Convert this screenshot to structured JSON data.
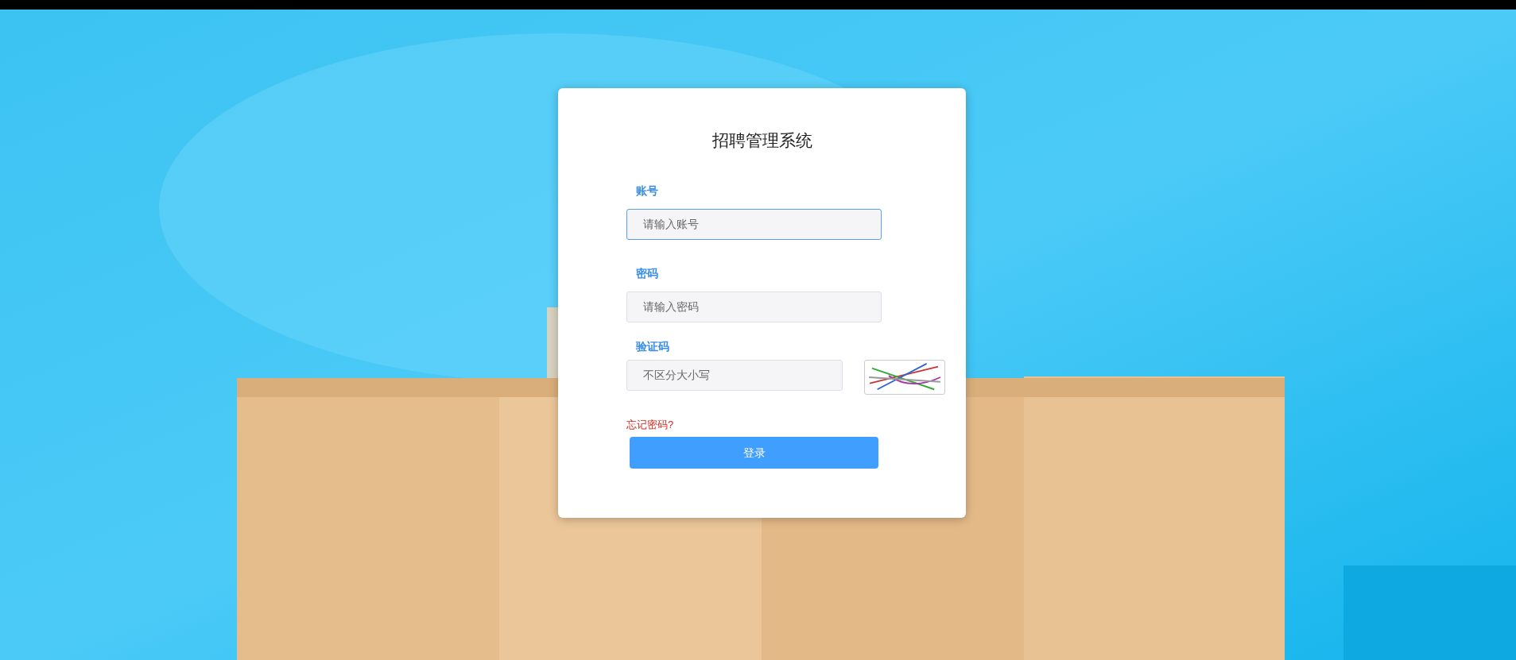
{
  "login_card": {
    "title": "招聘管理系统",
    "fields": [
      {
        "kind": "text",
        "label": "账号",
        "placeholder": "请输入账号",
        "focused": true
      },
      {
        "kind": "password",
        "label": "密码",
        "placeholder": "请输入密码",
        "focused": false
      },
      {
        "kind": "captcha",
        "label": "验证码",
        "placeholder": "不区分大小写",
        "focused": false
      }
    ],
    "forgot_link": "忘记密码?",
    "submit_button": "登录"
  }
}
